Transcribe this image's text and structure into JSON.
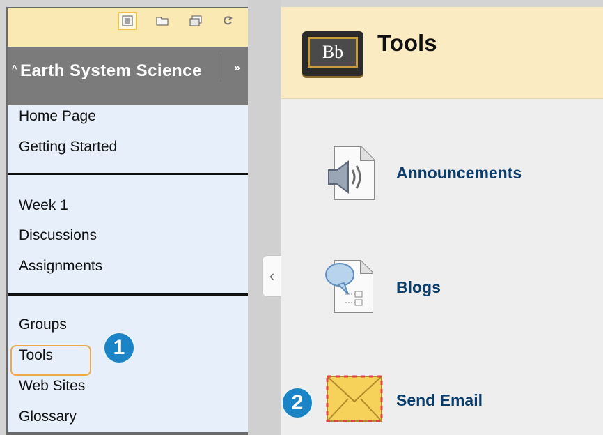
{
  "menu": {
    "toolbar": {
      "icons": [
        "list-view-icon",
        "folder-view-icon",
        "window-icon",
        "refresh-icon"
      ]
    },
    "course_title": "Earth System Science",
    "items_group1": [
      {
        "label": "Home Page"
      },
      {
        "label": "Getting Started"
      }
    ],
    "items_group2": [
      {
        "label": "Week 1"
      },
      {
        "label": "Discussions"
      },
      {
        "label": "Assignments"
      }
    ],
    "items_group3": [
      {
        "label": "Groups"
      },
      {
        "label": "Tools"
      },
      {
        "label": "Web Sites"
      },
      {
        "label": "Glossary"
      }
    ],
    "badge_1": "1"
  },
  "page": {
    "title": "Tools",
    "logo_text": "Bb",
    "tools": [
      {
        "label": "Announcements",
        "icon": "announcement-icon"
      },
      {
        "label": "Blogs",
        "icon": "blog-icon"
      },
      {
        "label": "Send Email",
        "icon": "email-icon"
      }
    ],
    "badge_2": "2"
  },
  "colors": {
    "menu_bg": "#e6effa",
    "toolbar_bg": "#fbe9b3",
    "title_bar": "#7b7b7b",
    "link": "#0a3d6b",
    "badge": "#1a84c6",
    "highlight": "#f0a84a"
  }
}
